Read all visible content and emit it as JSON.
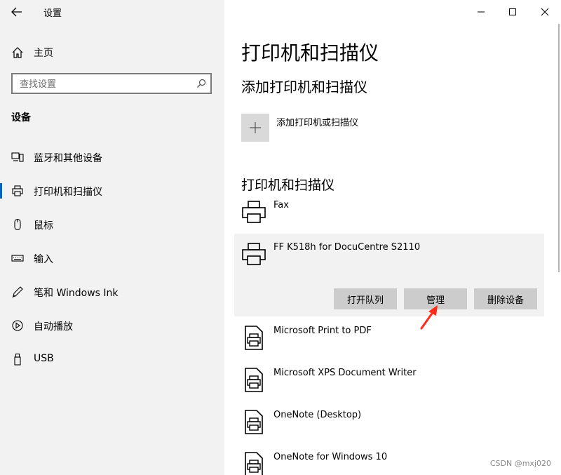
{
  "window": {
    "app_title": "设置",
    "controls": {
      "minimize": "minimize",
      "maximize": "maximize",
      "close": "close"
    }
  },
  "sidebar": {
    "home_label": "主页",
    "search": {
      "placeholder": "查找设置",
      "value": ""
    },
    "section_heading": "设备",
    "items": [
      {
        "label": "蓝牙和其他设备",
        "icon": "bluetooth-devices-icon",
        "active": false
      },
      {
        "label": "打印机和扫描仪",
        "icon": "printer-icon",
        "active": true
      },
      {
        "label": "鼠标",
        "icon": "mouse-icon",
        "active": false
      },
      {
        "label": "输入",
        "icon": "keyboard-icon",
        "active": false
      },
      {
        "label": "笔和 Windows Ink",
        "icon": "pen-icon",
        "active": false
      },
      {
        "label": "自动播放",
        "icon": "autoplay-icon",
        "active": false
      },
      {
        "label": "USB",
        "icon": "usb-icon",
        "active": false
      }
    ]
  },
  "main": {
    "page_title": "打印机和扫描仪",
    "add_section_title": "添加打印机和扫描仪",
    "add_button_label": "添加打印机或扫描仪",
    "list_section_title": "打印机和扫描仪",
    "devices": [
      {
        "name": "Fax",
        "icon": "printer-icon"
      },
      {
        "name": "FF K518h for DocuCentre S2110",
        "icon": "printer-icon",
        "selected": true,
        "actions": {
          "open_queue": "打开队列",
          "manage": "管理",
          "remove": "删除设备"
        }
      },
      {
        "name": "Microsoft Print to PDF",
        "icon": "document-printer-icon"
      },
      {
        "name": "Microsoft XPS Document Writer",
        "icon": "document-printer-icon"
      },
      {
        "name": "OneNote (Desktop)",
        "icon": "document-printer-icon"
      },
      {
        "name": "OneNote for Windows 10",
        "icon": "document-printer-icon"
      }
    ]
  },
  "watermark": "CSDN @mxj020",
  "colors": {
    "accent": "#0067c0",
    "annotation_arrow": "#ff2a1a",
    "sidebar_bg": "#f2f2f2"
  }
}
